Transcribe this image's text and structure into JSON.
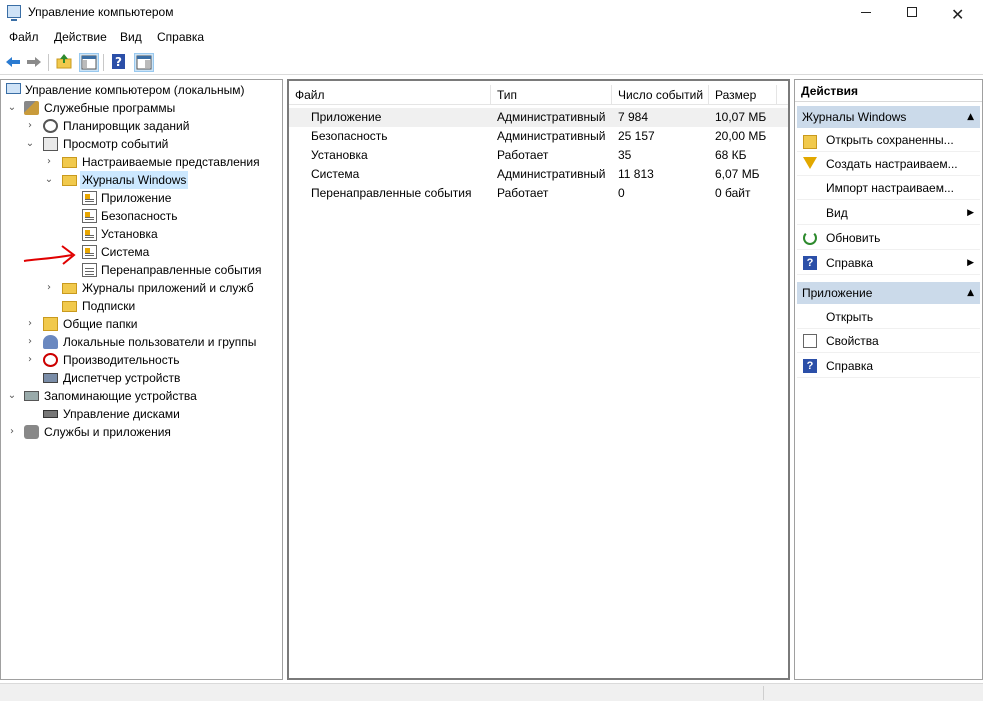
{
  "window": {
    "title": "Управление компьютером",
    "min_glyph": "",
    "max_glyph": "",
    "close_glyph": "✕"
  },
  "menu": {
    "file": "Файл",
    "action": "Действие",
    "view": "Вид",
    "help": "Справка"
  },
  "tree": {
    "root": "Управление компьютером (локальным)",
    "system_tools": "Служебные программы",
    "task_scheduler": "Планировщик заданий",
    "event_viewer": "Просмотр событий",
    "custom_views": "Настраиваемые представления",
    "windows_logs": "Журналы Windows",
    "log_application": "Приложение",
    "log_security": "Безопасность",
    "log_setup": "Установка",
    "log_system": "Система",
    "log_forwarded": "Перенаправленные события",
    "app_service_logs": "Журналы приложений и служб",
    "subscriptions": "Подписки",
    "shared_folders": "Общие папки",
    "local_users": "Локальные пользователи и группы",
    "performance": "Производительность",
    "device_manager": "Диспетчер устройств",
    "storage": "Запоминающие устройства",
    "disk_management": "Управление дисками",
    "services_apps": "Службы и приложения"
  },
  "table": {
    "columns": [
      "Файл",
      "Тип",
      "Число событий",
      "Размер"
    ],
    "rows": [
      [
        "Приложение",
        "Административный",
        "7 984",
        "10,07 МБ"
      ],
      [
        "Безопасность",
        "Административный",
        "25 157",
        "20,00 МБ"
      ],
      [
        "Установка",
        "Работает",
        "35",
        "68 КБ"
      ],
      [
        "Система",
        "Административный",
        "11 813",
        "6,07 МБ"
      ],
      [
        "Перенаправленные события",
        "Работает",
        "0",
        "0 байт"
      ]
    ]
  },
  "actions": {
    "header": "Действия",
    "section1": "Журналы Windows",
    "open_saved": "Открыть сохраненны...",
    "create_custom": "Создать настраиваем...",
    "import_custom": "Импорт настраиваем...",
    "view": "Вид",
    "refresh": "Обновить",
    "help": "Справка",
    "section2": "Приложение",
    "open": "Открыть",
    "properties": "Свойства",
    "help2": "Справка"
  },
  "colors": {
    "selection": "#cce8ff",
    "section_bg": "#cbdaea",
    "annotation": "#e00000"
  }
}
